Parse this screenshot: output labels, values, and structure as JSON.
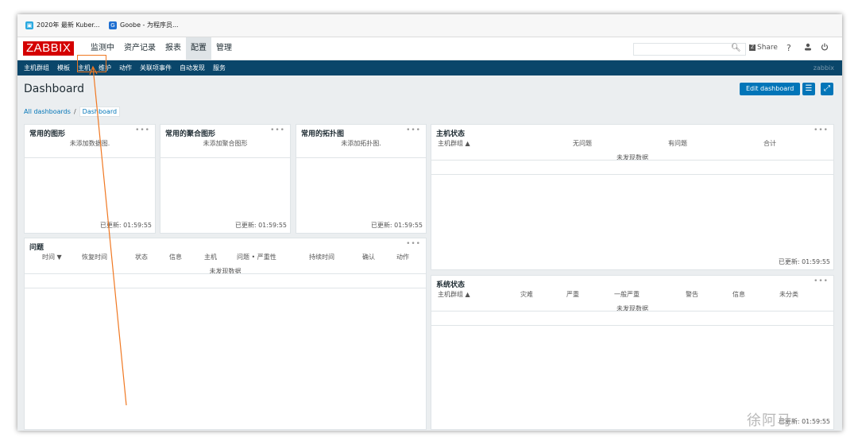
{
  "browser": {
    "bookmarks": [
      {
        "label": "2020年 最新 Kuber..."
      },
      {
        "label": "Goobe - 为程序员..."
      }
    ]
  },
  "header": {
    "logo": "ZABBIX",
    "menu": [
      "监测中",
      "资产记录",
      "报表",
      "配置",
      "管理"
    ],
    "share": "Share",
    "help_icon": "?",
    "user_icon": "person",
    "power_icon": "power"
  },
  "submenu": {
    "items": [
      "主机群组",
      "模板",
      "主机",
      "维护",
      "动作",
      "关联项事件",
      "自动发现",
      "服务"
    ],
    "right": "zabbix"
  },
  "page": {
    "title": "Dashboard",
    "edit_button": "Edit dashboard",
    "breadcrumb": {
      "all": "All dashboards",
      "sep": "/",
      "current": "Dashboard"
    }
  },
  "widgets": {
    "graphs": {
      "title": "常用的图形",
      "empty": "未添加数据图.",
      "updated": "已更新: 01:59:55"
    },
    "screens": {
      "title": "常用的聚合图形",
      "empty": "未添加聚合图形",
      "updated": "已更新: 01:59:55"
    },
    "maps": {
      "title": "常用的拓扑图",
      "empty": "未添加拓扑图.",
      "updated": "已更新: 01:59:55"
    },
    "problems": {
      "title": "问题",
      "columns": [
        "时间 ▼",
        "恢复时间",
        "状态",
        "信息",
        "主机",
        "问题 • 严重性",
        "持续时间",
        "确认",
        "动作"
      ],
      "empty": "未发现数据"
    },
    "host_status": {
      "title": "主机状态",
      "columns": [
        "主机群组 ▲",
        "无问题",
        "有问题",
        "合计"
      ],
      "empty": "未发现数据",
      "updated": "已更新: 01:59:55"
    },
    "system_status": {
      "title": "系统状态",
      "columns": [
        "主机群组 ▲",
        "灾难",
        "严重",
        "一般严重",
        "警告",
        "信息",
        "未分类"
      ],
      "empty": "未发现数据",
      "updated": "已更新: 01:59:55"
    }
  },
  "dots": "•••",
  "watermark": "徐阿马",
  "colors": {
    "accent": "#0275b8",
    "logo": "#d40000",
    "subbar": "#0a466a",
    "annotation": "#f07822"
  }
}
